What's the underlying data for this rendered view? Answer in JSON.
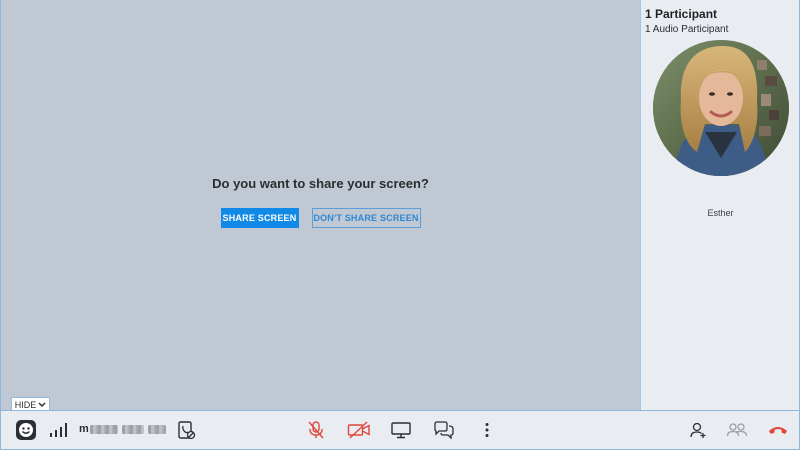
{
  "share": {
    "prompt": "Do you want to share your screen?",
    "share_label": "SHARE SCREEN",
    "dont_share_label": "DON'T SHARE SCREEN"
  },
  "panel": {
    "participants": "1 Participant",
    "audio_participants": "1 Audio Participant",
    "participant_name": "Esther"
  },
  "toggle": {
    "hide_label": "HIDE"
  },
  "toolbar": {
    "phone_prefix": "m",
    "icons": [
      "meeting-logo-icon",
      "signal-strength-icon",
      "phone-number-text",
      "dial-in-info-icon",
      "mic-muted-icon",
      "video-off-icon",
      "screen-share-icon",
      "chat-icon",
      "more-options-icon",
      "add-participant-icon",
      "participants-icon",
      "hang-up-icon"
    ]
  },
  "colors": {
    "share_bg": "#c0c9d3",
    "panel_bg": "#e9edf1",
    "primary": "#1189e6",
    "danger": "#e0463c",
    "border": "#8fb6dc"
  }
}
